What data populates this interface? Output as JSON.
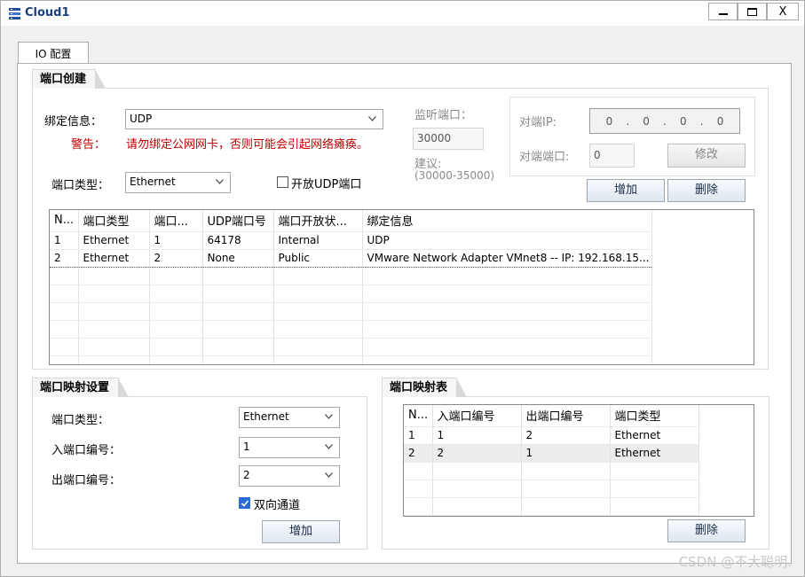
{
  "window": {
    "title": "Cloud1",
    "close_glyph": "X"
  },
  "tab": {
    "label": "IO 配置"
  },
  "port_create": {
    "header": "端口创建",
    "bind_label": "绑定信息：",
    "bind_value": "UDP",
    "warning_label": "警告：",
    "warning_text": "请勿绑定公网网卡，否则可能会引起网络瘫痪。",
    "listen_port_label": "监听端口：",
    "listen_port_value": "30000",
    "suggest_label": "建议:",
    "suggest_range": "(30000-35000)",
    "peer_ip_label": "对端IP:",
    "peer_ip_octets": [
      "0",
      "0",
      "0",
      "0"
    ],
    "peer_port_label": "对端端口:",
    "peer_port_value": "0",
    "modify_button": "修改",
    "port_type_label": "端口类型：",
    "port_type_value": "Ethernet",
    "open_udp_label": "开放UDP端口",
    "open_udp_checked": false,
    "add_button": "增加",
    "delete_button": "删除",
    "table": {
      "headers": [
        "N...",
        "端口类型",
        "端口...",
        "UDP端口号",
        "端口开放状...",
        "绑定信息"
      ],
      "rows": [
        [
          "1",
          "Ethernet",
          "1",
          "64178",
          "Internal",
          "UDP"
        ],
        [
          "2",
          "Ethernet",
          "2",
          "None",
          "Public",
          "VMware Network Adapter VMnet8 -- IP: 192.168.15..."
        ]
      ]
    }
  },
  "mapping_settings": {
    "header": "端口映射设置",
    "port_type_label": "端口类型：",
    "port_type_value": "Ethernet",
    "in_port_label": "入端口编号：",
    "in_port_value": "1",
    "out_port_label": "出端口编号：",
    "out_port_value": "2",
    "bidirectional_label": "双向通道",
    "bidirectional_checked": true,
    "add_button": "增加"
  },
  "mapping_table": {
    "header": "端口映射表",
    "headers": [
      "N...",
      "入端口编号",
      "出端口编号",
      "端口类型"
    ],
    "rows": [
      [
        "1",
        "1",
        "2",
        "Ethernet"
      ],
      [
        "2",
        "2",
        "1",
        "Ethernet"
      ]
    ],
    "delete_button": "删除"
  },
  "watermark": "CSDN @不大聪明."
}
